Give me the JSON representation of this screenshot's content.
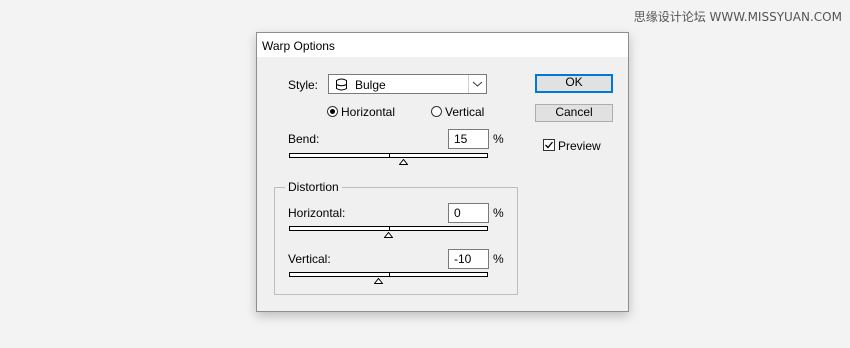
{
  "watermark": "思缘设计论坛 WWW.MISSYUAN.COM",
  "dialog": {
    "title": "Warp Options",
    "style": {
      "label": "Style:",
      "value": "Bulge",
      "icon": "bulge-shape-icon"
    },
    "orientation": {
      "horizontal_label": "Horizontal",
      "vertical_label": "Vertical",
      "selected": "Horizontal"
    },
    "bend": {
      "label": "Bend:",
      "value": "15",
      "unit": "%",
      "slider_fraction": 0.575
    },
    "distortion": {
      "title": "Distortion",
      "horizontal": {
        "label": "Horizontal:",
        "value": "0",
        "unit": "%",
        "slider_fraction": 0.5
      },
      "vertical": {
        "label": "Vertical:",
        "value": "-10",
        "unit": "%",
        "slider_fraction": 0.45
      }
    },
    "buttons": {
      "ok": "OK",
      "cancel": "Cancel"
    },
    "preview": {
      "label": "Preview",
      "checked": true
    },
    "colors": {
      "default_button_border": "#0078d7",
      "dialog_bg": "#f0f0f0"
    }
  }
}
